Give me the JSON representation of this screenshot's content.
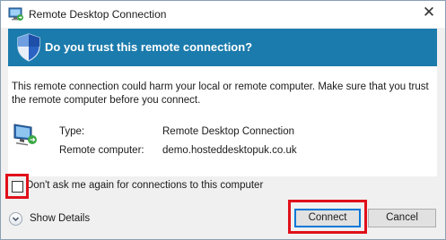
{
  "window": {
    "title": "Remote Desktop Connection",
    "close_glyph": "✕",
    "app_icon": "remote-desktop-icon"
  },
  "banner": {
    "title": "Do you trust this remote connection?",
    "icon": "shield-icon",
    "color": "#1b7bac"
  },
  "warning": {
    "text": "This remote connection could harm your local or remote computer. Make sure that you trust the remote computer before you connect."
  },
  "info": {
    "icon": "monitor-icon",
    "type_label": "Type:",
    "type_value": "Remote Desktop Connection",
    "computer_label": "Remote computer:",
    "computer_value": "demo.hosteddesktopuk.co.uk"
  },
  "options": {
    "dont_ask_label": "Don't ask me again for connections to this computer",
    "dont_ask_checked": false
  },
  "footer": {
    "show_details_label": "Show Details",
    "connect_label": "Connect",
    "cancel_label": "Cancel"
  },
  "highlight_color": "#e0101a"
}
